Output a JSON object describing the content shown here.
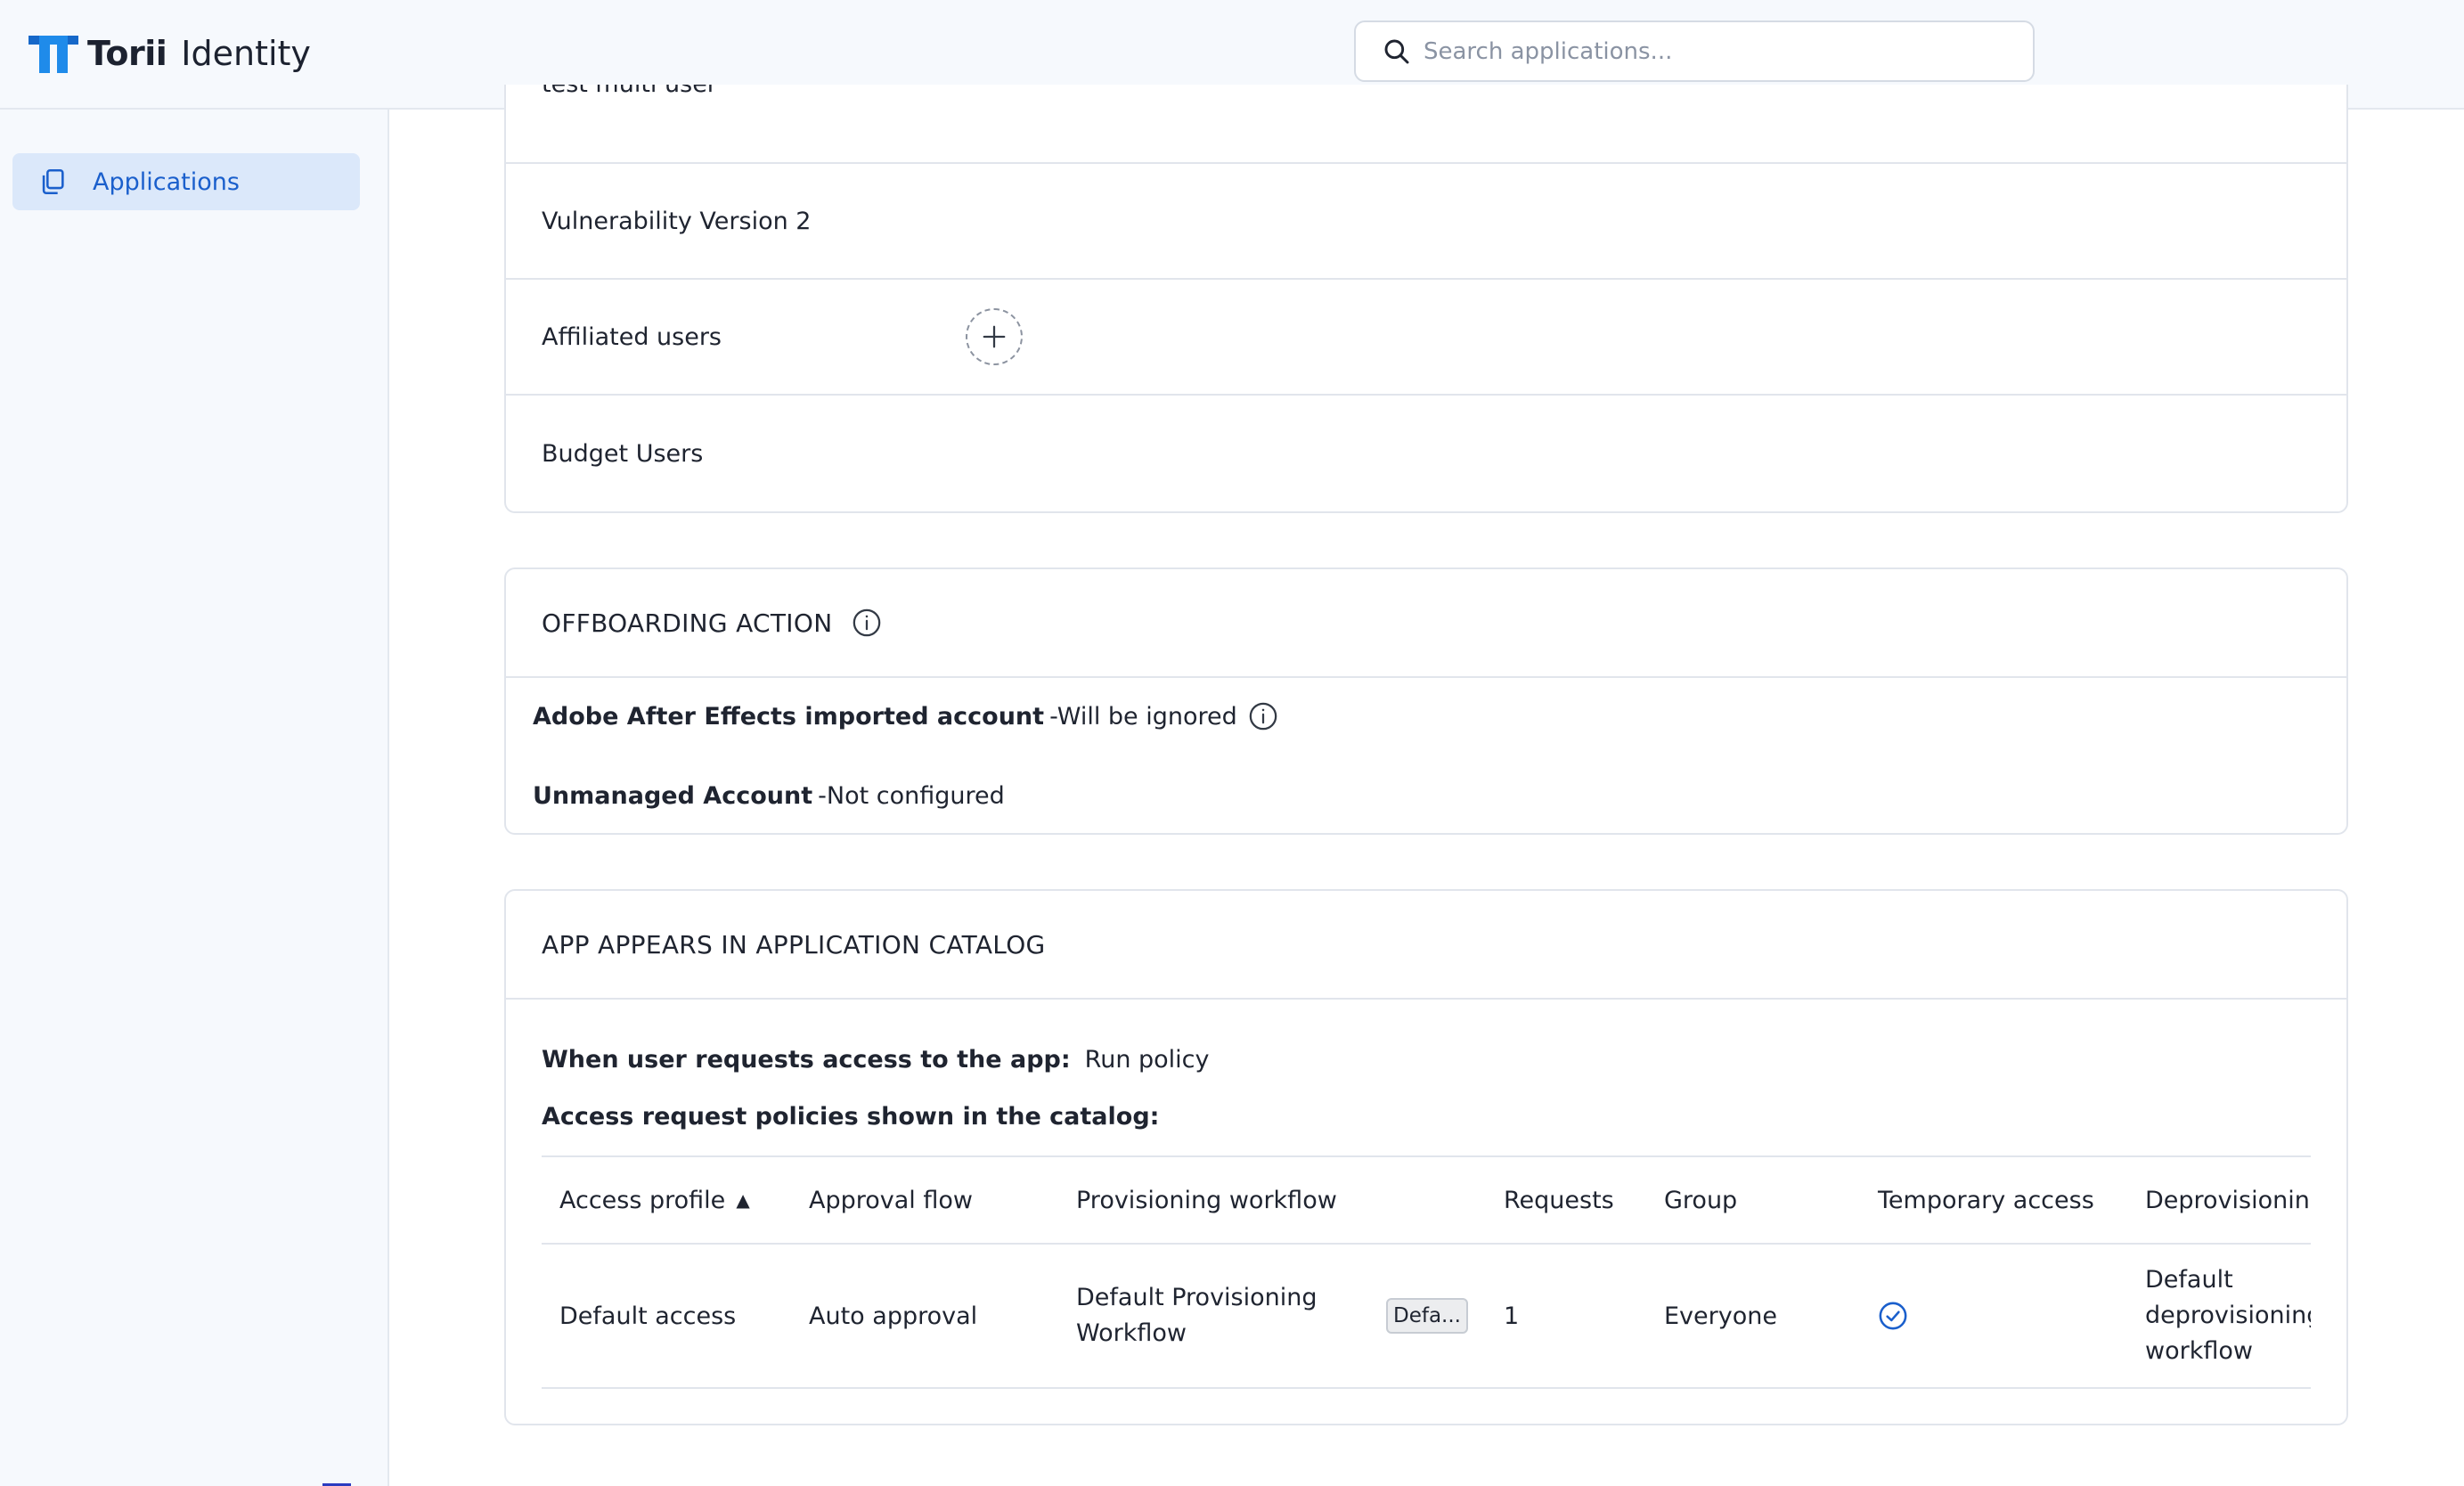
{
  "app": {
    "logo_bold": "Torii",
    "logo_light": "Identity"
  },
  "search": {
    "placeholder": "Search applications..."
  },
  "sidebar": {
    "items": [
      {
        "label": "Applications",
        "icon": "copy-icon",
        "active": true
      }
    ]
  },
  "details": {
    "partial_row": "test multi user",
    "rows": [
      {
        "label": "Vulnerability Version 2"
      },
      {
        "label": "Affiliated users"
      },
      {
        "label": "Budget Users"
      }
    ]
  },
  "offboarding": {
    "title": "OFFBOARDING ACTION",
    "lines": [
      {
        "name": "Adobe After Effects imported account",
        "status": "-Will be ignored"
      },
      {
        "name": "Unmanaged Account",
        "status": "-Not configured"
      }
    ]
  },
  "catalog": {
    "title": "APP APPEARS IN APPLICATION CATALOG",
    "request_label": "When user requests access to the app:",
    "request_value": "Run policy",
    "policies_label": "Access request policies shown in the catalog:",
    "columns": [
      "Access profile",
      "Approval flow",
      "Provisioning workflow",
      "Requests",
      "Group",
      "Temporary access",
      "Deprovisioning"
    ],
    "rows": [
      {
        "access_profile": "Default access",
        "approval_flow": "Auto approval",
        "provisioning_workflow": "Default Provisioning Workflow",
        "chip": "Defa...",
        "requests": "1",
        "group": "Everyone",
        "temporary_access": true,
        "deprovisioning": "Default deprovisioning workflow"
      }
    ]
  },
  "colors": {
    "accent": "#1a5fcc",
    "logo_blue": "#1f8bea",
    "sidebar_bg": "#f6f9fd",
    "active_nav_bg": "#dbe8fa",
    "border": "#e1e5ec"
  }
}
